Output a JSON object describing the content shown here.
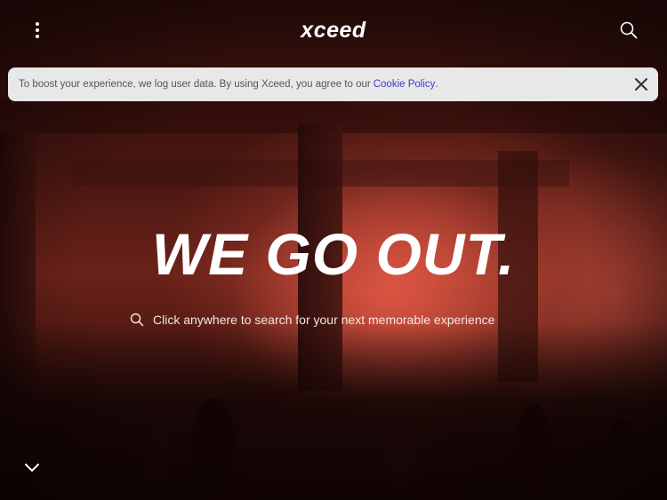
{
  "header": {
    "logo": "xceed",
    "menu_icon": "vertical-dots-icon",
    "search_icon": "search-icon"
  },
  "cookie_banner": {
    "text": "To boost your experience, we log user data. By using Xceed, you agree to our",
    "link_label": "Cookie Policy",
    "link_suffix": ".",
    "close_icon": "close-icon"
  },
  "hero": {
    "headline": "WE GO OUT.",
    "search_prompt": "Click anywhere to search for your next memorable experience",
    "search_icon": "search-icon",
    "scroll_icon": "chevron-down-icon"
  },
  "colors": {
    "banner_bg": "#e8e8e8",
    "link": "#3b3bd1",
    "text_on_hero": "#ffffff"
  }
}
